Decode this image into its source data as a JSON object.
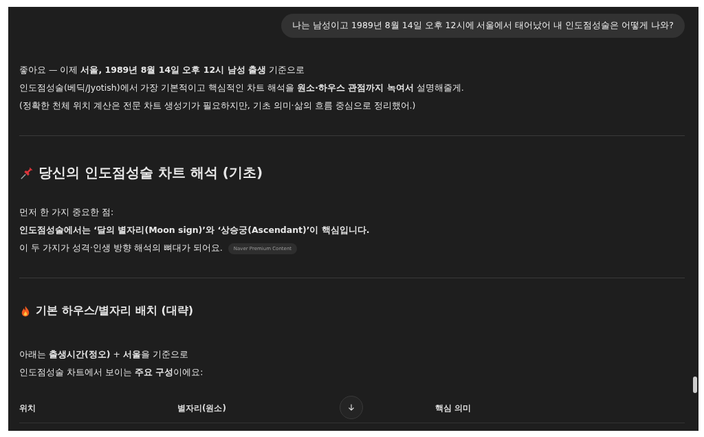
{
  "user_message": "나는 남성이고 1989년 8월 14일 오후 12시에 서울에서 태어났어 내 인도점성술은 어떻게 나와?",
  "intro": [
    "좋아요 — 이제 **서울, 1989년 8월 14일 오후 12시 남성 출생** 기준으로",
    "인도점성술(베딕/Jyotish)에서 가장 기본적이고 핵심적인 차트 해석을 **원소·하우스 관점까지 녹여서** 설명해줄게.",
    "(정확한 천체 위치 계산은 전문 차트 생성기가 필요하지만, 기초 의미·삶의 흐름 중심으로 정리했어.)"
  ],
  "sections": [
    {
      "heading": "당신의 인도점성술 차트 해석 (기초)",
      "lines": [
        "먼저 한 가지 중요한 점:",
        "**인도점성술에서는 ‘달의 별자리(Moon sign)’와 ‘상승궁(Ascendant)’이 핵심입니다.**",
        "이 두 가지가 성격·인생 방향 해석의 뼈대가 되어요."
      ],
      "badge": "Naver Premium Content"
    },
    {
      "heading": "기본 하우스/별자리 배치 (대략)",
      "lines": [
        "아래는 **출생시간(정오)** + **서울**을 기준으로",
        "인도점성술 차트에서 보이는 **주요 구성**이에요:"
      ]
    }
  ],
  "table": {
    "columns": [
      "위치",
      "별자리(원소)",
      "핵심 의미"
    ]
  }
}
